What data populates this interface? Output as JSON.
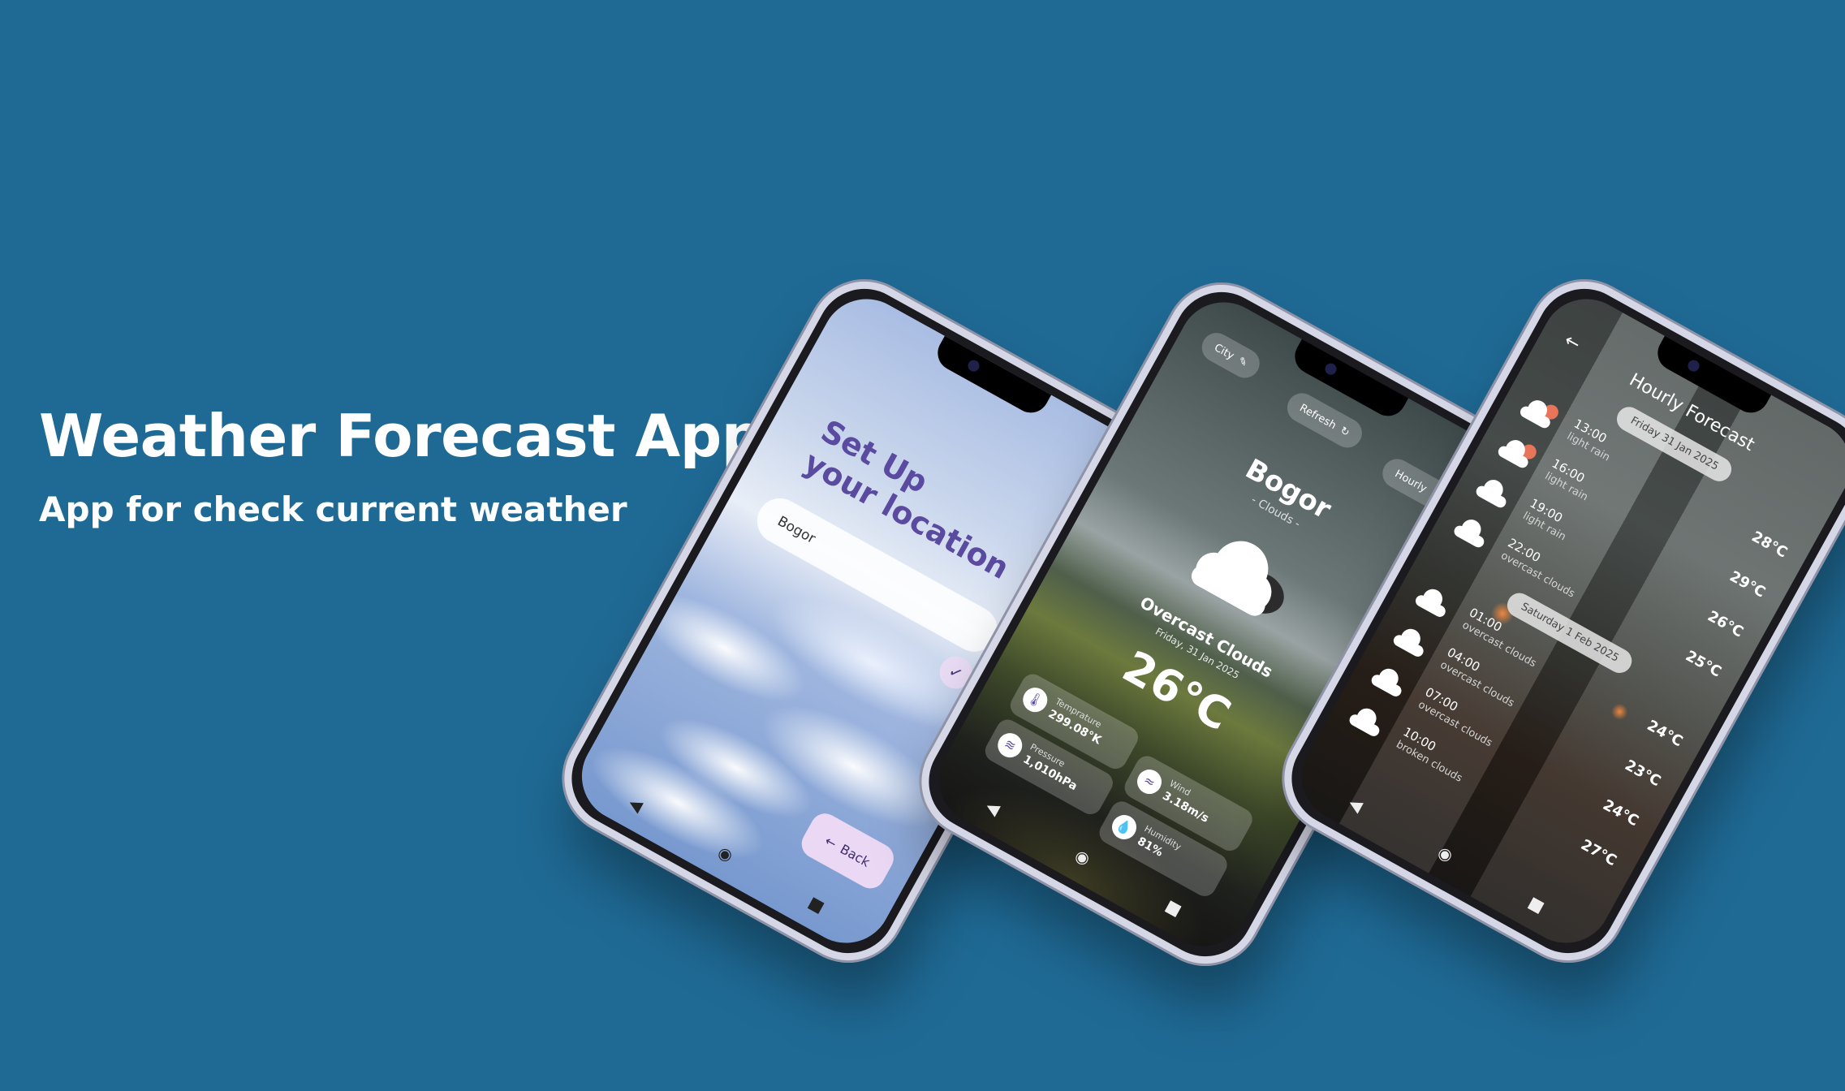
{
  "headline": {
    "title": "Weather Forecast App",
    "subtitle": "App for check current weather"
  },
  "colors": {
    "background": "#1f6a95",
    "accent": "#5a4ba0"
  },
  "setup_screen": {
    "title_line1": "Set Up",
    "title_line2": "your location",
    "location_value": "Bogor",
    "check_icon": "check-icon",
    "back_label": "Back",
    "back_icon": "arrow-left-icon"
  },
  "current_screen": {
    "chips": {
      "city": "City",
      "refresh": "Refresh",
      "hourly": "Hourly"
    },
    "city": "Bogor",
    "subtitle": "- Clouds -",
    "description": "Overcast Clouds",
    "date": "Friday, 31 Jan 2025",
    "temperature": "26℃",
    "cards": {
      "temperature": {
        "label": "Temprature",
        "value": "299.08°K"
      },
      "pressure": {
        "label": "Pressure",
        "value": "1,010hPa"
      },
      "wind": {
        "label": "Wind",
        "value": "3.18m/s"
      },
      "humidity": {
        "label": "Humidity",
        "value": "81%"
      }
    }
  },
  "hourly_screen": {
    "title": "Hourly Forecast",
    "days": [
      {
        "label": "Friday 31 Jan 2025",
        "hours": [
          {
            "time": "13:00",
            "desc": "light rain",
            "temp": "28℃"
          },
          {
            "time": "16:00",
            "desc": "light rain",
            "temp": "29℃"
          },
          {
            "time": "19:00",
            "desc": "light rain",
            "temp": "26℃"
          },
          {
            "time": "22:00",
            "desc": "overcast clouds",
            "temp": "25℃"
          }
        ]
      },
      {
        "label": "Saturday 1 Feb 2025",
        "hours": [
          {
            "time": "01:00",
            "desc": "overcast clouds",
            "temp": "24℃"
          },
          {
            "time": "04:00",
            "desc": "overcast clouds",
            "temp": "23℃"
          },
          {
            "time": "07:00",
            "desc": "overcast clouds",
            "temp": "24℃"
          },
          {
            "time": "10:00",
            "desc": "broken clouds",
            "temp": "27℃"
          }
        ]
      }
    ]
  }
}
